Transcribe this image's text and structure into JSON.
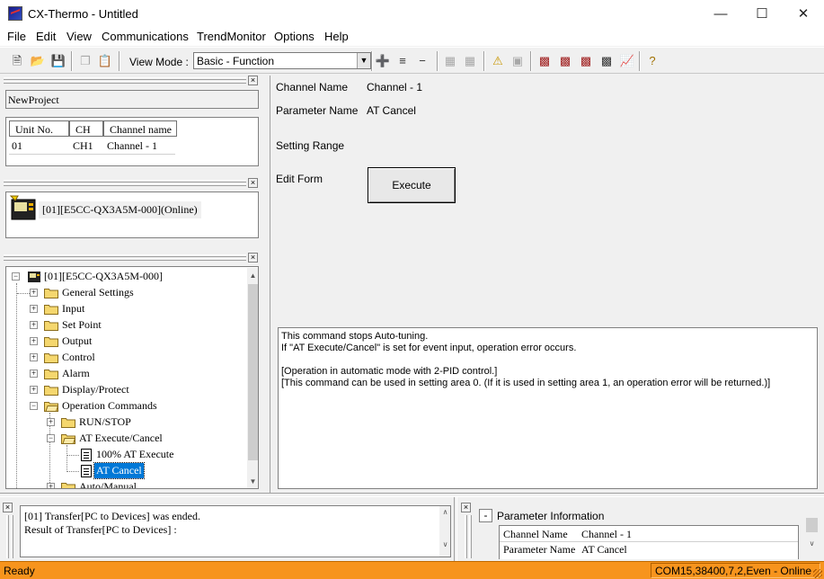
{
  "window": {
    "title": "CX-Thermo - Untitled",
    "min_icon": "minimize-icon",
    "max_icon": "maximize-icon",
    "close_icon": "close-icon"
  },
  "menu": [
    "File",
    "Edit",
    "View",
    "Communications",
    "TrendMonitor",
    "Options",
    "Help"
  ],
  "toolbar": {
    "view_mode_label": "View Mode :",
    "view_mode_value": "Basic - Function",
    "icons": [
      "new-file-icon",
      "open-folder-icon",
      "save-icon",
      "copy-icon",
      "paste-icon",
      "add-icon",
      "insert-icon",
      "remove-icon",
      "grid-icon",
      "table-icon",
      "warning-icon",
      "image-icon",
      "device-transfer-icon",
      "device-compare-icon",
      "device-upload-icon",
      "device-download-icon",
      "monitor-icon",
      "help-icon"
    ]
  },
  "project": {
    "name": "NewProject"
  },
  "unit_table": {
    "headers": [
      "Unit No.",
      "CH",
      "Channel name"
    ],
    "rows": [
      [
        "01",
        "CH1",
        "Channel - 1"
      ]
    ]
  },
  "device": {
    "label": "[01][E5CC-QX3A5M-000](Online)"
  },
  "tree": {
    "root": "[01][E5CC-QX3A5M-000]",
    "items": [
      "General Settings",
      "Input",
      "Set Point",
      "Output",
      "Control",
      "Alarm",
      "Display/Protect",
      "Operation Commands"
    ],
    "op_children": [
      "RUN/STOP",
      "AT Execute/Cancel"
    ],
    "at_children": [
      "100% AT Execute",
      "AT Cancel"
    ],
    "partial": "Auto/Manual"
  },
  "detail": {
    "channel_name_label": "Channel Name",
    "channel_name_value": "Channel - 1",
    "parameter_name_label": "Parameter Name",
    "parameter_name_value": "AT Cancel",
    "setting_range_label": "Setting Range",
    "edit_form_label": "Edit Form",
    "execute_label": "Execute",
    "description": [
      "This command stops Auto-tuning.",
      "If \"AT Execute/Cancel\" is set for event input, operation error occurs.",
      "",
      "[Operation in automatic mode with 2-PID control.]",
      "[This command can be used in setting area 0. (If it is used in setting area 1, an operation error will be returned.)]"
    ]
  },
  "log": {
    "lines": [
      "[01] Transfer[PC to Devices] was ended.",
      "Result of Transfer[PC to Devices] :"
    ]
  },
  "param_info": {
    "title": "Parameter Information",
    "collapse": "-",
    "rows": [
      [
        "Channel Name",
        "Channel - 1"
      ],
      [
        "Parameter Name",
        "AT Cancel"
      ]
    ]
  },
  "status": {
    "left": "Ready",
    "right": "COM15,38400,7,2,Even - Online"
  }
}
